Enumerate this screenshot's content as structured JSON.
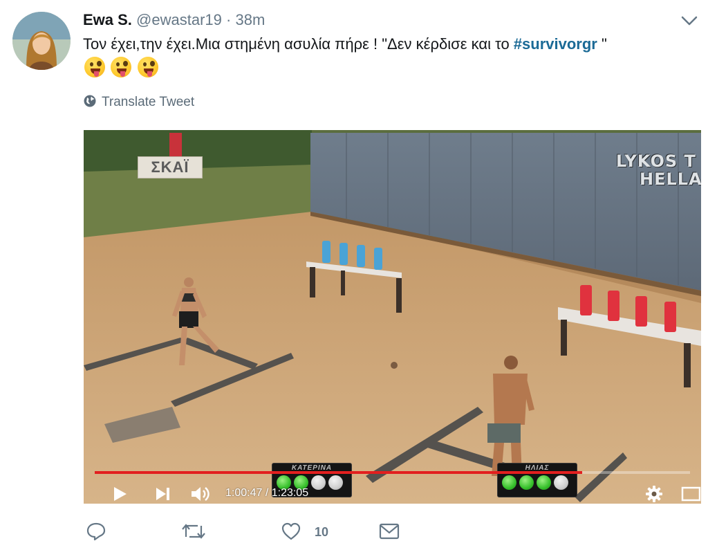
{
  "tweet": {
    "display_name": "Ewa S.",
    "handle": "@ewastar19",
    "separator": "·",
    "time": "38m",
    "text_before": "Τον έχει,την έχει.Μια στημένη ασυλία πήρε ! \"Δεν κέρδισε και το ",
    "hashtag": "#survivorgr",
    "text_after": " \"",
    "emojis": [
      "zany-face-emoji",
      "zany-face-emoji",
      "zany-face-emoji"
    ],
    "translate_label": "Translate Tweet"
  },
  "video": {
    "channel_logo": "ΣΚΑΪ",
    "watermark_line1": "LYKOS T",
    "watermark_line2": "HELLA",
    "scoreboard_left": {
      "name": "ΚΑΤΕΡΙΝΑ",
      "lights": [
        "on",
        "on",
        "off",
        "off"
      ]
    },
    "scoreboard_right": {
      "name": "ΗΛΙΑΣ",
      "lights": [
        "on",
        "on",
        "on",
        "off"
      ]
    },
    "time_display": "1:00:47 / 1:23:05",
    "progress_percent": 81.9,
    "controls": [
      "play-icon",
      "next-icon",
      "volume-icon",
      "settings-icon",
      "fullscreen-icon"
    ]
  },
  "actions": {
    "like_count": "10",
    "icons": [
      "reply-icon",
      "retweet-icon",
      "like-icon",
      "direct-message-icon"
    ]
  },
  "colors": {
    "hashtag": "#1b6a96",
    "secondary_text": "#657786",
    "progress": "#e21f1f",
    "light_on": "#36c02b"
  }
}
